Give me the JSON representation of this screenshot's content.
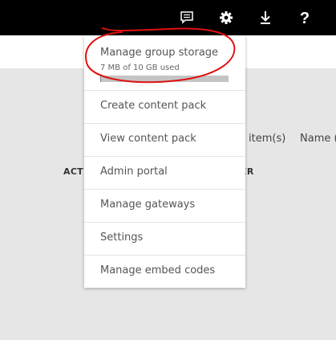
{
  "topbar": {
    "icons": [
      "feedback-icon",
      "gear-icon",
      "download-icon",
      "help-icon"
    ],
    "help_label": "?"
  },
  "background": {
    "items_fragment": "item(s)",
    "name_fragment": "Name (",
    "col_left_fragment": "ACTI",
    "col_right_fragment": "ER"
  },
  "menu": {
    "storage": {
      "title": "Manage group storage",
      "usage": "7 MB of 10 GB used",
      "used_fraction": 0.0007
    },
    "items": [
      "Create content pack",
      "View content pack",
      "Admin portal",
      "Manage gateways",
      "Settings",
      "Manage embed codes"
    ]
  },
  "colors": {
    "topbar": "#000000",
    "annotation": "#e01010",
    "storage_bar": "#c4c4c4"
  }
}
